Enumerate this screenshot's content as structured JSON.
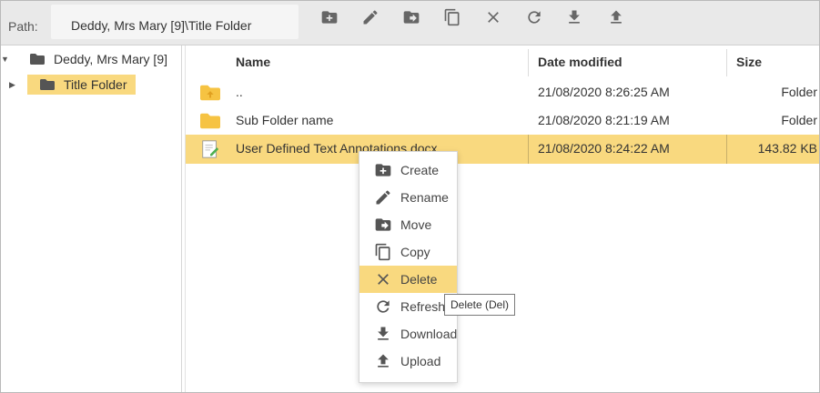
{
  "path": {
    "label": "Path:",
    "value": "Deddy, Mrs Mary [9]\\Title Folder"
  },
  "toolbar": {
    "icons": [
      "create-folder-icon",
      "rename-icon",
      "move-icon",
      "copy-icon",
      "delete-icon",
      "refresh-icon",
      "download-icon",
      "upload-icon"
    ]
  },
  "tree": {
    "root": "Deddy, Mrs Mary [9]",
    "child": "Title Folder"
  },
  "list": {
    "columns": {
      "name": "Name",
      "date": "Date modified",
      "size": "Size"
    },
    "rows": [
      {
        "name": "..",
        "date": "21/08/2020 8:26:25 AM",
        "size": "Folder",
        "icon": "parent-folder-icon"
      },
      {
        "name": "Sub Folder name",
        "date": "21/08/2020 8:21:19 AM",
        "size": "Folder",
        "icon": "folder-icon"
      },
      {
        "name": "User Defined Text Annotations.docx",
        "date": "21/08/2020 8:24:22 AM",
        "size": "143.82 KB",
        "icon": "document-icon"
      }
    ]
  },
  "context_menu": {
    "items": [
      {
        "label": "Create",
        "icon": "create-folder-icon"
      },
      {
        "label": "Rename",
        "icon": "rename-icon"
      },
      {
        "label": "Move",
        "icon": "move-icon"
      },
      {
        "label": "Copy",
        "icon": "copy-icon"
      },
      {
        "label": "Delete",
        "icon": "delete-icon"
      },
      {
        "label": "Refresh",
        "icon": "refresh-icon"
      },
      {
        "label": "Download",
        "icon": "download-icon"
      },
      {
        "label": "Upload",
        "icon": "upload-icon"
      }
    ],
    "highlighted": "Delete"
  },
  "tooltip": {
    "text": "Delete (Del)"
  },
  "colors": {
    "selection": "#f9d97f",
    "toolbar_bg": "#e9e9e9",
    "icon": "#666666"
  }
}
